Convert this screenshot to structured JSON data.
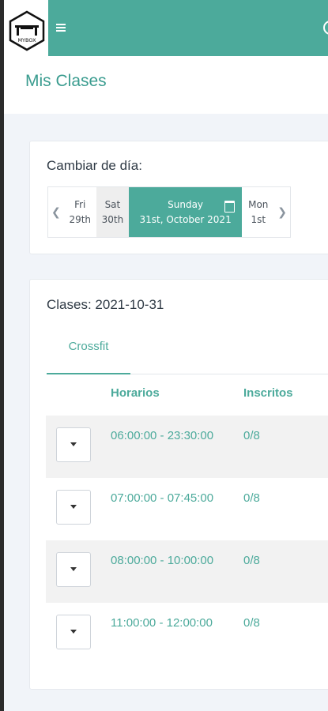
{
  "header": {
    "logo_text": "MYBOX"
  },
  "page": {
    "title": "Mis Clases"
  },
  "day_card": {
    "title": "Cambiar de día:",
    "days": [
      {
        "label": "Fri",
        "date": "29th"
      },
      {
        "label": "Sat",
        "date": "30th"
      },
      {
        "label": "Sunday",
        "date": "31st, October 2021"
      },
      {
        "label": "Mon",
        "date": "1st"
      }
    ]
  },
  "classes_card": {
    "title": "Clases: 2021-10-31",
    "tab": "Crossfit",
    "columns": {
      "schedule": "Horarios",
      "enrolled": "Inscritos"
    },
    "rows": [
      {
        "time": "06:00:00 - 23:30:00",
        "count": "0/8"
      },
      {
        "time": "07:00:00 - 07:45:00",
        "count": "0/8"
      },
      {
        "time": "08:00:00 - 10:00:00",
        "count": "0/8"
      },
      {
        "time": "11:00:00 - 12:00:00",
        "count": "0/8"
      }
    ]
  },
  "colors": {
    "accent": "#4caa9b",
    "background": "#f1f4f9"
  },
  "icons": [
    "hamburger-menu-icon",
    "user-icon",
    "chevron-left-icon",
    "chevron-right-icon",
    "calendar-icon",
    "caret-down-icon"
  ]
}
